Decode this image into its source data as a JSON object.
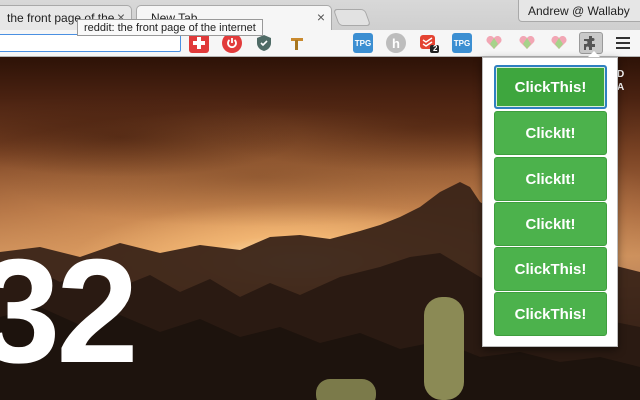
{
  "tabs": [
    {
      "title": "the front page of the internet",
      "close": "×"
    },
    {
      "title": "New Tab",
      "close": "×"
    }
  ],
  "tooltip": "reddit: the front page of the internet",
  "profile": "Andrew @ Wallaby",
  "omnibox": {
    "value": ""
  },
  "extensions": [
    {
      "name": "red-puzzle-extension"
    },
    {
      "name": "power-extension"
    },
    {
      "name": "shield-extension"
    },
    {
      "name": "tool-extension"
    },
    {
      "name": "tpg-extension",
      "label": "TPG"
    },
    {
      "name": "h-extension",
      "label": "h"
    },
    {
      "name": "todoist-extension",
      "badge": "2"
    },
    {
      "name": "tpg-extension-2",
      "label": "TPG"
    },
    {
      "name": "heart-extension"
    },
    {
      "name": "heart-extension-2"
    },
    {
      "name": "heart-extension-3"
    },
    {
      "name": "puzzle-extension"
    }
  ],
  "clock": "32",
  "side_text": [
    "D",
    "A"
  ],
  "popup": {
    "buttons": [
      "ClickThis!",
      "ClickIt!",
      "ClickIt!",
      "ClickIt!",
      "ClickThis!",
      "ClickThis!"
    ]
  }
}
